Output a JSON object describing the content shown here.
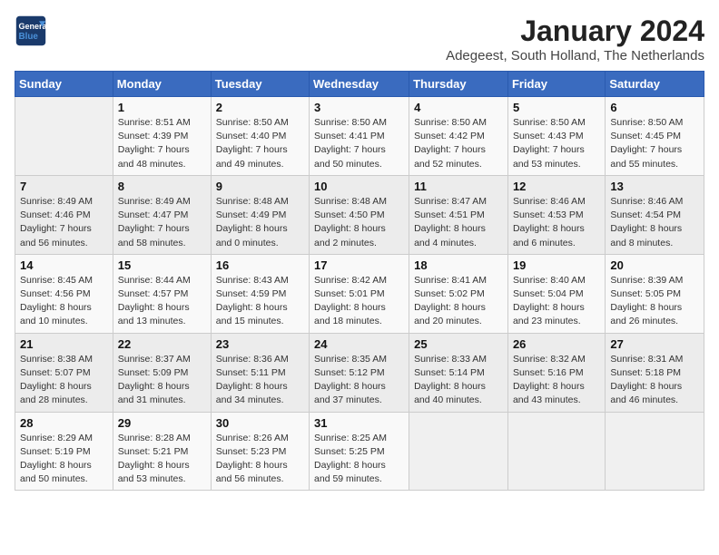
{
  "logo": {
    "general": "General",
    "blue": "Blue"
  },
  "header": {
    "month": "January 2024",
    "location": "Adegeest, South Holland, The Netherlands"
  },
  "weekdays": [
    "Sunday",
    "Monday",
    "Tuesday",
    "Wednesday",
    "Thursday",
    "Friday",
    "Saturday"
  ],
  "weeks": [
    [
      {
        "day": "",
        "sunrise": "",
        "sunset": "",
        "daylight": ""
      },
      {
        "day": "1",
        "sunrise": "Sunrise: 8:51 AM",
        "sunset": "Sunset: 4:39 PM",
        "daylight": "Daylight: 7 hours and 48 minutes."
      },
      {
        "day": "2",
        "sunrise": "Sunrise: 8:50 AM",
        "sunset": "Sunset: 4:40 PM",
        "daylight": "Daylight: 7 hours and 49 minutes."
      },
      {
        "day": "3",
        "sunrise": "Sunrise: 8:50 AM",
        "sunset": "Sunset: 4:41 PM",
        "daylight": "Daylight: 7 hours and 50 minutes."
      },
      {
        "day": "4",
        "sunrise": "Sunrise: 8:50 AM",
        "sunset": "Sunset: 4:42 PM",
        "daylight": "Daylight: 7 hours and 52 minutes."
      },
      {
        "day": "5",
        "sunrise": "Sunrise: 8:50 AM",
        "sunset": "Sunset: 4:43 PM",
        "daylight": "Daylight: 7 hours and 53 minutes."
      },
      {
        "day": "6",
        "sunrise": "Sunrise: 8:50 AM",
        "sunset": "Sunset: 4:45 PM",
        "daylight": "Daylight: 7 hours and 55 minutes."
      }
    ],
    [
      {
        "day": "7",
        "sunrise": "Sunrise: 8:49 AM",
        "sunset": "Sunset: 4:46 PM",
        "daylight": "Daylight: 7 hours and 56 minutes."
      },
      {
        "day": "8",
        "sunrise": "Sunrise: 8:49 AM",
        "sunset": "Sunset: 4:47 PM",
        "daylight": "Daylight: 7 hours and 58 minutes."
      },
      {
        "day": "9",
        "sunrise": "Sunrise: 8:48 AM",
        "sunset": "Sunset: 4:49 PM",
        "daylight": "Daylight: 8 hours and 0 minutes."
      },
      {
        "day": "10",
        "sunrise": "Sunrise: 8:48 AM",
        "sunset": "Sunset: 4:50 PM",
        "daylight": "Daylight: 8 hours and 2 minutes."
      },
      {
        "day": "11",
        "sunrise": "Sunrise: 8:47 AM",
        "sunset": "Sunset: 4:51 PM",
        "daylight": "Daylight: 8 hours and 4 minutes."
      },
      {
        "day": "12",
        "sunrise": "Sunrise: 8:46 AM",
        "sunset": "Sunset: 4:53 PM",
        "daylight": "Daylight: 8 hours and 6 minutes."
      },
      {
        "day": "13",
        "sunrise": "Sunrise: 8:46 AM",
        "sunset": "Sunset: 4:54 PM",
        "daylight": "Daylight: 8 hours and 8 minutes."
      }
    ],
    [
      {
        "day": "14",
        "sunrise": "Sunrise: 8:45 AM",
        "sunset": "Sunset: 4:56 PM",
        "daylight": "Daylight: 8 hours and 10 minutes."
      },
      {
        "day": "15",
        "sunrise": "Sunrise: 8:44 AM",
        "sunset": "Sunset: 4:57 PM",
        "daylight": "Daylight: 8 hours and 13 minutes."
      },
      {
        "day": "16",
        "sunrise": "Sunrise: 8:43 AM",
        "sunset": "Sunset: 4:59 PM",
        "daylight": "Daylight: 8 hours and 15 minutes."
      },
      {
        "day": "17",
        "sunrise": "Sunrise: 8:42 AM",
        "sunset": "Sunset: 5:01 PM",
        "daylight": "Daylight: 8 hours and 18 minutes."
      },
      {
        "day": "18",
        "sunrise": "Sunrise: 8:41 AM",
        "sunset": "Sunset: 5:02 PM",
        "daylight": "Daylight: 8 hours and 20 minutes."
      },
      {
        "day": "19",
        "sunrise": "Sunrise: 8:40 AM",
        "sunset": "Sunset: 5:04 PM",
        "daylight": "Daylight: 8 hours and 23 minutes."
      },
      {
        "day": "20",
        "sunrise": "Sunrise: 8:39 AM",
        "sunset": "Sunset: 5:05 PM",
        "daylight": "Daylight: 8 hours and 26 minutes."
      }
    ],
    [
      {
        "day": "21",
        "sunrise": "Sunrise: 8:38 AM",
        "sunset": "Sunset: 5:07 PM",
        "daylight": "Daylight: 8 hours and 28 minutes."
      },
      {
        "day": "22",
        "sunrise": "Sunrise: 8:37 AM",
        "sunset": "Sunset: 5:09 PM",
        "daylight": "Daylight: 8 hours and 31 minutes."
      },
      {
        "day": "23",
        "sunrise": "Sunrise: 8:36 AM",
        "sunset": "Sunset: 5:11 PM",
        "daylight": "Daylight: 8 hours and 34 minutes."
      },
      {
        "day": "24",
        "sunrise": "Sunrise: 8:35 AM",
        "sunset": "Sunset: 5:12 PM",
        "daylight": "Daylight: 8 hours and 37 minutes."
      },
      {
        "day": "25",
        "sunrise": "Sunrise: 8:33 AM",
        "sunset": "Sunset: 5:14 PM",
        "daylight": "Daylight: 8 hours and 40 minutes."
      },
      {
        "day": "26",
        "sunrise": "Sunrise: 8:32 AM",
        "sunset": "Sunset: 5:16 PM",
        "daylight": "Daylight: 8 hours and 43 minutes."
      },
      {
        "day": "27",
        "sunrise": "Sunrise: 8:31 AM",
        "sunset": "Sunset: 5:18 PM",
        "daylight": "Daylight: 8 hours and 46 minutes."
      }
    ],
    [
      {
        "day": "28",
        "sunrise": "Sunrise: 8:29 AM",
        "sunset": "Sunset: 5:19 PM",
        "daylight": "Daylight: 8 hours and 50 minutes."
      },
      {
        "day": "29",
        "sunrise": "Sunrise: 8:28 AM",
        "sunset": "Sunset: 5:21 PM",
        "daylight": "Daylight: 8 hours and 53 minutes."
      },
      {
        "day": "30",
        "sunrise": "Sunrise: 8:26 AM",
        "sunset": "Sunset: 5:23 PM",
        "daylight": "Daylight: 8 hours and 56 minutes."
      },
      {
        "day": "31",
        "sunrise": "Sunrise: 8:25 AM",
        "sunset": "Sunset: 5:25 PM",
        "daylight": "Daylight: 8 hours and 59 minutes."
      },
      {
        "day": "",
        "sunrise": "",
        "sunset": "",
        "daylight": ""
      },
      {
        "day": "",
        "sunrise": "",
        "sunset": "",
        "daylight": ""
      },
      {
        "day": "",
        "sunrise": "",
        "sunset": "",
        "daylight": ""
      }
    ]
  ]
}
